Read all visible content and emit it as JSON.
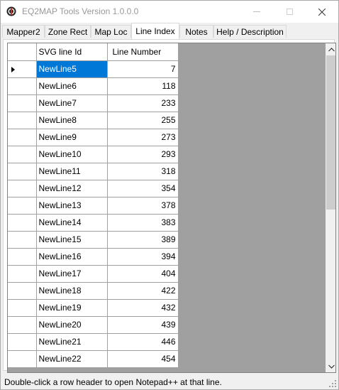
{
  "window": {
    "title": "EQ2MAP Tools Version 1.0.0.0",
    "icon": "app-logo-icon",
    "controls": [
      "minimize-icon",
      "maximize-icon",
      "close-icon"
    ]
  },
  "tabs": [
    {
      "label": "Mapper2",
      "active": false
    },
    {
      "label": "Zone Rect",
      "active": false
    },
    {
      "label": "Map Loc",
      "active": false
    },
    {
      "label": "Line Index",
      "active": true
    },
    {
      "label": "Notes",
      "active": false
    },
    {
      "label": "Help / Description",
      "active": false
    }
  ],
  "grid": {
    "columns": [
      "SVG line Id",
      "Line Number"
    ],
    "selected_row": 0,
    "rows": [
      {
        "id": "NewLine5",
        "line": "7"
      },
      {
        "id": "NewLine6",
        "line": "118"
      },
      {
        "id": "NewLine7",
        "line": "233"
      },
      {
        "id": "NewLine8",
        "line": "255"
      },
      {
        "id": "NewLine9",
        "line": "273"
      },
      {
        "id": "NewLine10",
        "line": "293"
      },
      {
        "id": "NewLine11",
        "line": "318"
      },
      {
        "id": "NewLine12",
        "line": "354"
      },
      {
        "id": "NewLine13",
        "line": "378"
      },
      {
        "id": "NewLine14",
        "line": "383"
      },
      {
        "id": "NewLine15",
        "line": "389"
      },
      {
        "id": "NewLine16",
        "line": "394"
      },
      {
        "id": "NewLine17",
        "line": "404"
      },
      {
        "id": "NewLine18",
        "line": "422"
      },
      {
        "id": "NewLine19",
        "line": "432"
      },
      {
        "id": "NewLine20",
        "line": "439"
      },
      {
        "id": "NewLine21",
        "line": "446"
      },
      {
        "id": "NewLine22",
        "line": "454"
      }
    ]
  },
  "status": {
    "text": "Double-click a row header to open Notepad++ at that line."
  },
  "colors": {
    "selection": "#0078d7",
    "grid_background": "#a0a0a0"
  }
}
